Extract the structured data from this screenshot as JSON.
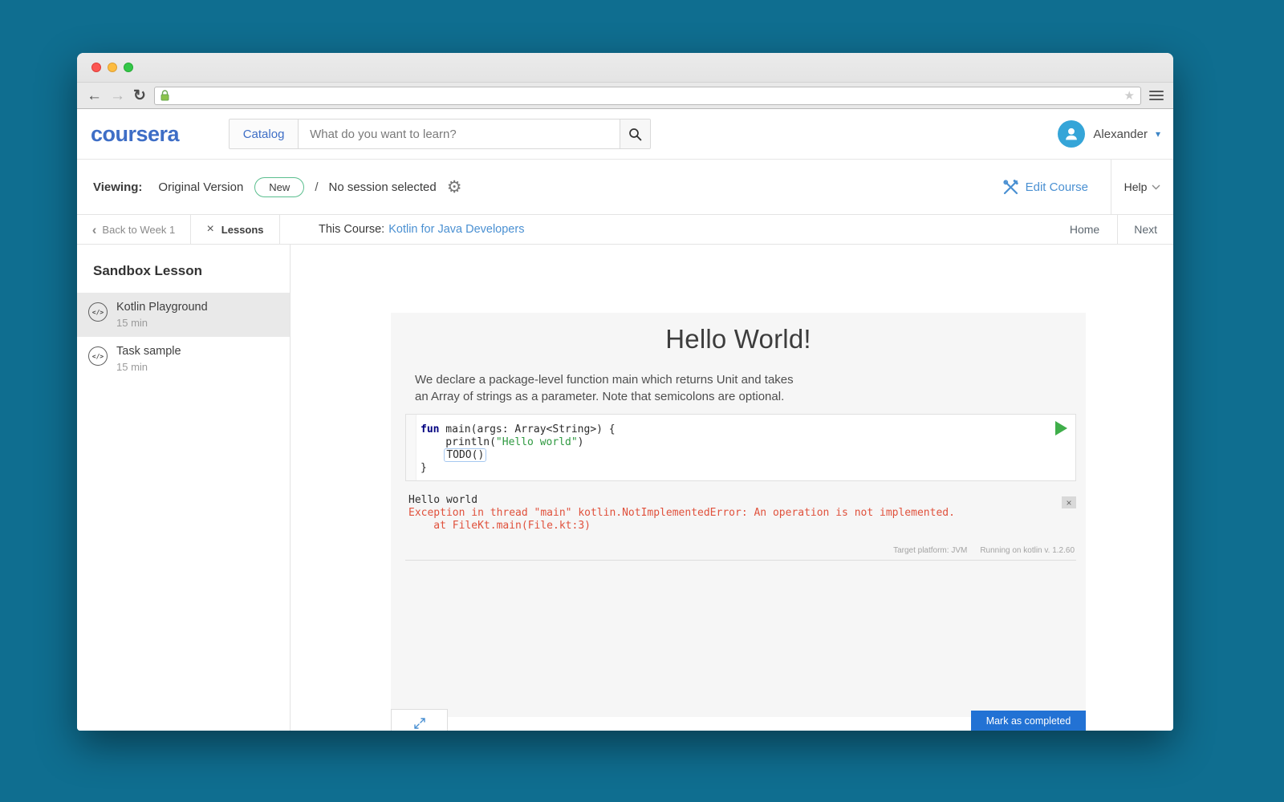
{
  "colors": {
    "page_bg": "#0f6e90",
    "brand": "#3e6ec6",
    "link": "#4a90d2",
    "accent": "#2272d4",
    "success": "#3fae4a",
    "error": "#e0513c",
    "avatar": "#35a5d8",
    "badge": "#5abe8e",
    "keyword": "#000080",
    "string": "#2e9940"
  },
  "icons": {
    "back": "←",
    "forward": "→",
    "reload": "↻",
    "star": "★",
    "caret_down": "▾",
    "chevron_left": "‹",
    "close": "×",
    "gear": "⚙",
    "code": "</>"
  },
  "browser": {
    "url": ""
  },
  "header": {
    "logo": "coursera",
    "catalog_label": "Catalog",
    "search_placeholder": "What do you want to learn?",
    "user_name": "Alexander"
  },
  "viewing_bar": {
    "label": "Viewing:",
    "version": "Original Version",
    "badge": "New",
    "slash": "/",
    "session": "No session selected",
    "edit_course": "Edit Course",
    "help": "Help"
  },
  "nav_bar": {
    "back": "Back to Week 1",
    "lessons": "Lessons",
    "course_prefix": "This Course:",
    "course_link": "Kotlin for Java Developers",
    "home": "Home",
    "next": "Next"
  },
  "sidebar": {
    "title": "Sandbox Lesson",
    "items": [
      {
        "label": "Kotlin Playground",
        "duration": "15 min"
      },
      {
        "label": "Task sample",
        "duration": "15 min"
      }
    ]
  },
  "lesson": {
    "title": "Hello World!",
    "description": {
      "line1": "We declare a package-level function main which returns Unit and takes",
      "line2": "an Array of strings as a parameter. Note that semicolons are optional."
    },
    "code": {
      "l1_keyword": "fun",
      "l1_rest": " main(args: Array<String>) {",
      "l2_prefix": "    println(",
      "l2_string": "\"Hello world\"",
      "l2_suffix": ")",
      "l3_indent": "    ",
      "l3_code": "TODO()",
      "l4": "}"
    },
    "output": {
      "stdout": "Hello world",
      "error_line1": "Exception in thread \"main\" kotlin.NotImplementedError: An operation is not implemented.",
      "error_line2": "    at FileKt.main(File.kt:3)",
      "platform": "Target platform: JVM",
      "runtime": "Running on kotlin v. 1.2.60"
    },
    "mark_completed": "Mark as completed"
  }
}
